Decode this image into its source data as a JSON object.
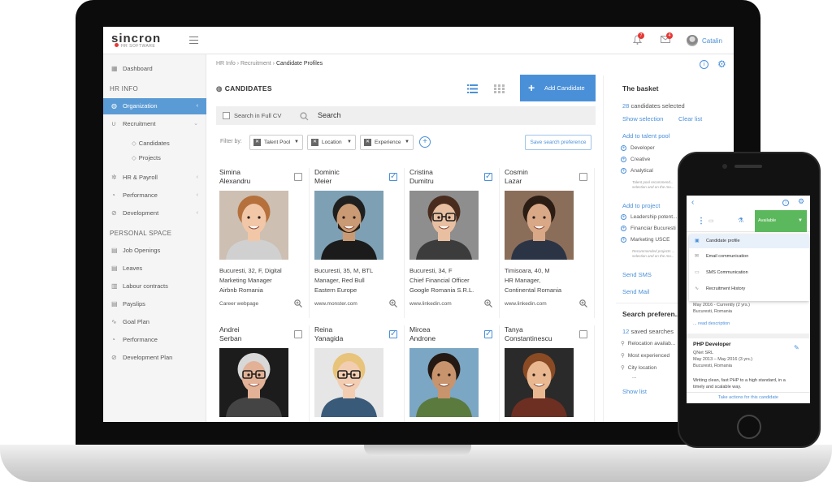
{
  "app": {
    "logo_text": "sincron",
    "logo_sub": "HR SOFTWARE"
  },
  "topbar": {
    "user_name": "Catalin",
    "badge_1": "7",
    "badge_2": "4"
  },
  "sidebar": {
    "dashboard": "Dashboard",
    "hr_info_section": "HR INFO",
    "organization": "Organization",
    "recruitment": "Recruitment",
    "candidates": "Candidates",
    "projects": "Projects",
    "hr_payroll": "HR & Payroll",
    "performance": "Performance",
    "development": "Development",
    "personal_section": "PERSONAL SPACE",
    "job_openings": "Job Openings",
    "leaves": "Leaves",
    "labour_contracts": "Labour contracts",
    "payslips": "Payslips",
    "goal_plan": "Goal Plan",
    "performance_personal": "Performance",
    "development_plan": "Development Plan"
  },
  "breadcrumb": {
    "a": "HR Info",
    "b": "Recruitment",
    "c": "Candidate Profiles",
    "sep": "›"
  },
  "main": {
    "title": "CANDIDATES",
    "add_button": "Add Candidate",
    "search_full_cv": "Search in Full CV",
    "search_label": "Search",
    "filter_by": "Filter by:",
    "chip_talent": "Talent Pool",
    "chip_location": "Location",
    "chip_experience": "Experience",
    "save_pref": "Save search preference"
  },
  "candidates": [
    {
      "first": "Simina",
      "last": "Alexandru",
      "d1": "Bucuresti, 32, F, Digital",
      "d2": "Marketing Manager",
      "d3": "Airbnb Romania",
      "src": "Career webpage",
      "checked": false
    },
    {
      "first": "Dominic",
      "last": "Meier",
      "d1": "Bucuresti, 35, M, BTL",
      "d2": "Manager, Red Bull",
      "d3": "Eastern Europe",
      "src": "www.monster.com",
      "checked": true
    },
    {
      "first": "Cristina",
      "last": "Dumitru",
      "d1": "Bucuresti, 34, F",
      "d2": "Chief Financial Officer",
      "d3": "Google Romania S.R.L.",
      "src": "www.linkedin.com",
      "checked": true
    },
    {
      "first": "Cosmin",
      "last": "Lazar",
      "d1": "Timisoara, 40, M",
      "d2": "HR Manager,",
      "d3": "Continental Romania",
      "src": "www.linkedin.com",
      "checked": false
    },
    {
      "first": "Andrei",
      "last": "Serban",
      "checked": false
    },
    {
      "first": "Reina",
      "last": "Yanagida",
      "checked": true
    },
    {
      "first": "Mircea",
      "last": "Androne",
      "checked": true
    },
    {
      "first": "Tanya",
      "last": "Constantinescu",
      "checked": false
    }
  ],
  "basket": {
    "title": "The basket",
    "count": "28",
    "count_suffix": "candidates selected",
    "show_selection": "Show selection",
    "clear_list": "Clear list",
    "add_talent": "Add to talent pool",
    "pool_1": "Developer",
    "pool_2": "Creative",
    "pool_3": "Analytical",
    "pool_note_1": "Talent pool recommend...",
    "pool_note_2": "selection and on the mo...",
    "add_project": "Add to project",
    "proj_1": "Leadership potent...",
    "proj_2": "Financiar Bucuresti",
    "proj_3": "Marketing USCE",
    "proj_note_1": "Recommended projects ...",
    "proj_note_2": "selection and on the mo...",
    "send_sms": "Send SMS",
    "send_mail": "Send Mail",
    "search_pref_title": "Search preferen...",
    "saved_count": "12",
    "saved_suffix": "saved searches",
    "pref_1": "Relocation availab...",
    "pref_2": "Most experienced",
    "pref_3": "City location",
    "ellipsis": "...",
    "show_list": "Show list"
  },
  "phone": {
    "status": "Available",
    "menu_1": "Candidate profile",
    "menu_2": "Email communication",
    "menu_3": "SMS Communication",
    "menu_4": "Recruitment History",
    "job1_dates": "May 2016 - Currently (2 yrs.)",
    "job1_city": "Bucuresti, Romania",
    "read_desc": "... read description",
    "job2_title": "PHP Developer",
    "job2_company": "QNet SRL",
    "job2_dates": "May 2013 – May 2016 (3 yrs.)",
    "job2_city": "Bucuresti, Romania",
    "job2_desc_1": "Writing clean, fast PHP to a high standard, in a",
    "job2_desc_2": "timely and scalable way.",
    "footer": "Take actions for this candidate"
  }
}
